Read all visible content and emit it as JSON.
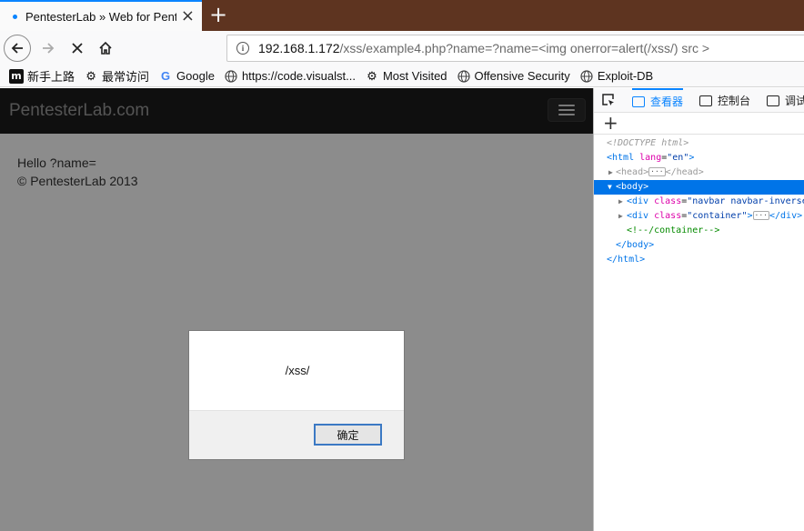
{
  "browser": {
    "tab": {
      "title": "PentesterLab » Web for Pent"
    },
    "url": {
      "host": "192.168.1.172",
      "path": "/xss/example4.php?name=?name=<img onerror=alert(/xss/) src >"
    },
    "bookmarks": [
      {
        "label": "新手上路",
        "icon": "m-logo-icon"
      },
      {
        "label": "最常访问",
        "icon": "gear-icon"
      },
      {
        "label": "Google",
        "icon": "google-g-icon"
      },
      {
        "label": "https://code.visualst...",
        "icon": "globe-icon"
      },
      {
        "label": "Most Visited",
        "icon": "gear-icon"
      },
      {
        "label": "Offensive Security",
        "icon": "globe-icon"
      },
      {
        "label": "Exploit-DB",
        "icon": "globe-icon"
      }
    ]
  },
  "page": {
    "brand": "PentesterLab.com",
    "greeting": "Hello ?name=",
    "copyright": "© PentesterLab 2013"
  },
  "alert": {
    "message": "/xss/",
    "ok_label": "确定"
  },
  "devtools": {
    "tabs": [
      {
        "label": "查看器",
        "active": true
      },
      {
        "label": "控制台",
        "active": false
      },
      {
        "label": "调试",
        "active": false
      }
    ],
    "tree": {
      "doctype": "<!DOCTYPE html>",
      "html_open_tag": "<html",
      "html_attr": "lang",
      "html_attr_val": "\"en\"",
      "html_close_bracket": ">",
      "head_open": "<head>",
      "head_close": "</head>",
      "body_open": "<body>",
      "div1_open": "<div",
      "div1_attr": "class",
      "div1_val": "\"navbar navbar-inverse",
      "div2_open": "<div",
      "div2_attr": "class",
      "div2_val": "\"container\"",
      "div2_gt": ">",
      "div2_close": "</div>",
      "comment": "<!--/container-->",
      "body_close": "</body>",
      "html_close": "</html>"
    }
  },
  "colors": {
    "tabstrip": "#5e3420",
    "accent": "#0a84ff",
    "site_nav": "#1d1d1d",
    "selection": "#0074e8"
  }
}
